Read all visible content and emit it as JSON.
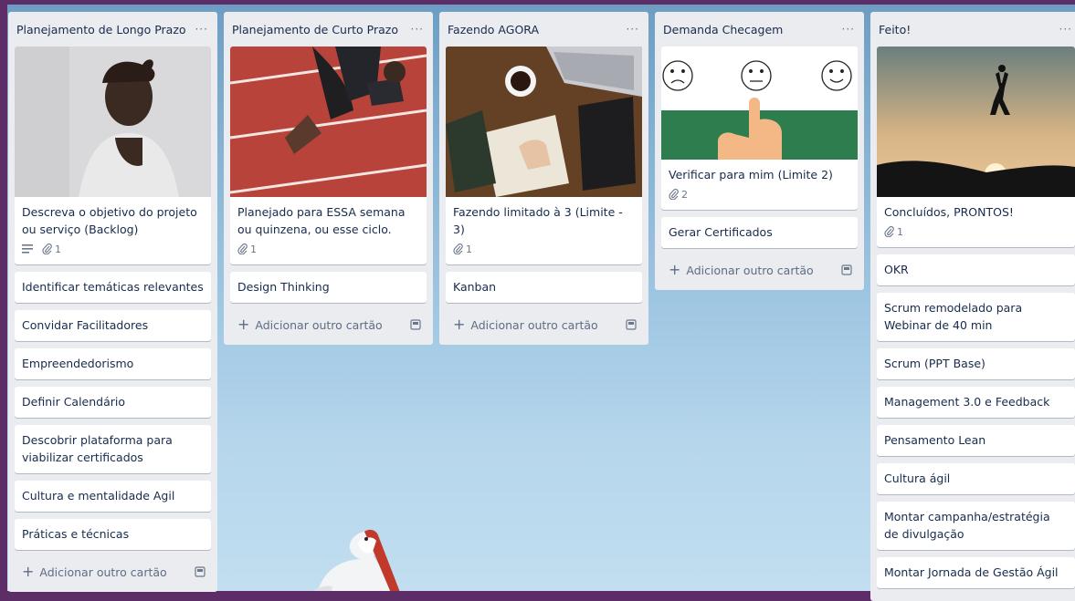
{
  "board": {
    "lists": [
      {
        "title": "Planejamento de Longo Prazo",
        "cards": [
          {
            "text": "Descreva o objetivo do projeto ou serviço (Backlog)",
            "attachments": "1"
          },
          {
            "text": "Identificar temáticas relevantes"
          },
          {
            "text": "Convidar Facilitadores"
          },
          {
            "text": "Empreendedorismo"
          },
          {
            "text": "Definir Calendário"
          },
          {
            "text": "Descobrir plataforma para viabilizar certificados"
          },
          {
            "text": "Cultura e mentalidade Agil"
          },
          {
            "text": "Práticas e técnicas"
          }
        ],
        "add_label": "Adicionar outro cartão"
      },
      {
        "title": "Planejamento de Curto Prazo",
        "cards": [
          {
            "text": "Planejado para ESSA semana ou quinzena, ou esse ciclo.",
            "attachments": "1"
          },
          {
            "text": "Design Thinking"
          }
        ],
        "add_label": "Adicionar outro cartão"
      },
      {
        "title": "Fazendo AGORA",
        "cards": [
          {
            "text": "Fazendo limitado à 3 (Limite - 3)",
            "attachments": "1"
          },
          {
            "text": "Kanban"
          }
        ],
        "add_label": "Adicionar outro cartão"
      },
      {
        "title": "Demanda Checagem",
        "cards": [
          {
            "text": "Verificar para mim (Limite 2)",
            "attachments": "2"
          },
          {
            "text": "Gerar Certificados"
          }
        ],
        "add_label": "Adicionar outro cartão"
      },
      {
        "title": "Feito!",
        "cards": [
          {
            "text": "Concluídos, PRONTOS!",
            "attachments": "1"
          },
          {
            "text": "OKR"
          },
          {
            "text": "Scrum remodelado para Webinar de 40 min"
          },
          {
            "text": "Scrum (PPT Base)"
          },
          {
            "text": "Management 3.0 e Feedback"
          },
          {
            "text": "Pensamento Lean"
          },
          {
            "text": "Cultura ágil"
          },
          {
            "text": "Montar campanha/estratégia de divulgação"
          },
          {
            "text": "Montar Jornada de Gestão Ágil"
          }
        ]
      }
    ],
    "menu_glyph": "···",
    "plus_glyph": "+"
  },
  "colors": {
    "list_bg": "#ebecf0",
    "text": "#172b4d",
    "muted": "#6b778c",
    "frame": "#5d2d67"
  },
  "icons": {
    "menu": "ellipsis-icon",
    "description": "description-lines-icon",
    "attachment": "paperclip-icon",
    "template": "card-template-icon"
  }
}
